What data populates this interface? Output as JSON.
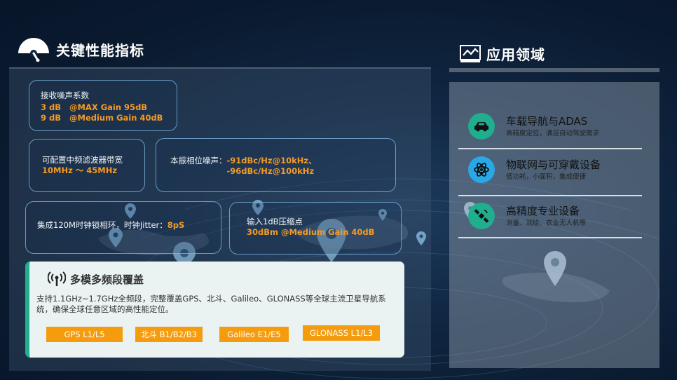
{
  "left_header": {
    "title": "关键性能指标"
  },
  "kpi": {
    "noise": {
      "label": "接收噪声系数",
      "lines": [
        "3 dB   @MAX Gain 95dB",
        "9 dB   @Medium Gain 40dB"
      ]
    },
    "filter": {
      "label": "可配置中频滤波器带宽",
      "value": "10MHz ～ 45MHz"
    },
    "phase": {
      "label": "本振相位噪声：",
      "line1": "-91dBc/Hz@10kHz、",
      "line2": "-96dBc/Hz@100kHz"
    },
    "clock": {
      "label": "集成120M时钟锁相环，时钟Jitter：",
      "value": "8pS"
    },
    "compression": {
      "label": "输入1dB压缩点",
      "value": "30dBm  @Medium Gain 40dB"
    }
  },
  "coverage": {
    "title": "多模多频段覆盖",
    "description": "支持1.1GHz~1.7GHz全频段，完整覆盖GPS、北斗、Galileo、GLONASS等全球主流卫星导航系统，确保全球任意区域的高性能定位。",
    "tags": [
      "GPS L1/L5",
      "北斗 B1/B2/B3",
      "Galileo E1/E5",
      "GLONASS L1/L3"
    ]
  },
  "right_header": {
    "title": "应用领域"
  },
  "applications": [
    {
      "title": "车载导航与ADAS",
      "subtitle": "高精度定位，满足自动驾驶需求",
      "icon": "car-icon"
    },
    {
      "title": "物联网与可穿戴设备",
      "subtitle": "低功耗，小面积，集成便捷",
      "icon": "atom-icon"
    },
    {
      "title": "高精度专业设备",
      "subtitle": "测量、测绘、农业无人机等",
      "icon": "satellite-icon"
    }
  ],
  "colors": {
    "accent": "#f59a23",
    "teal": "#1fae8e",
    "circle_green": "#1fae8e",
    "circle_blue": "#29a8e8"
  }
}
